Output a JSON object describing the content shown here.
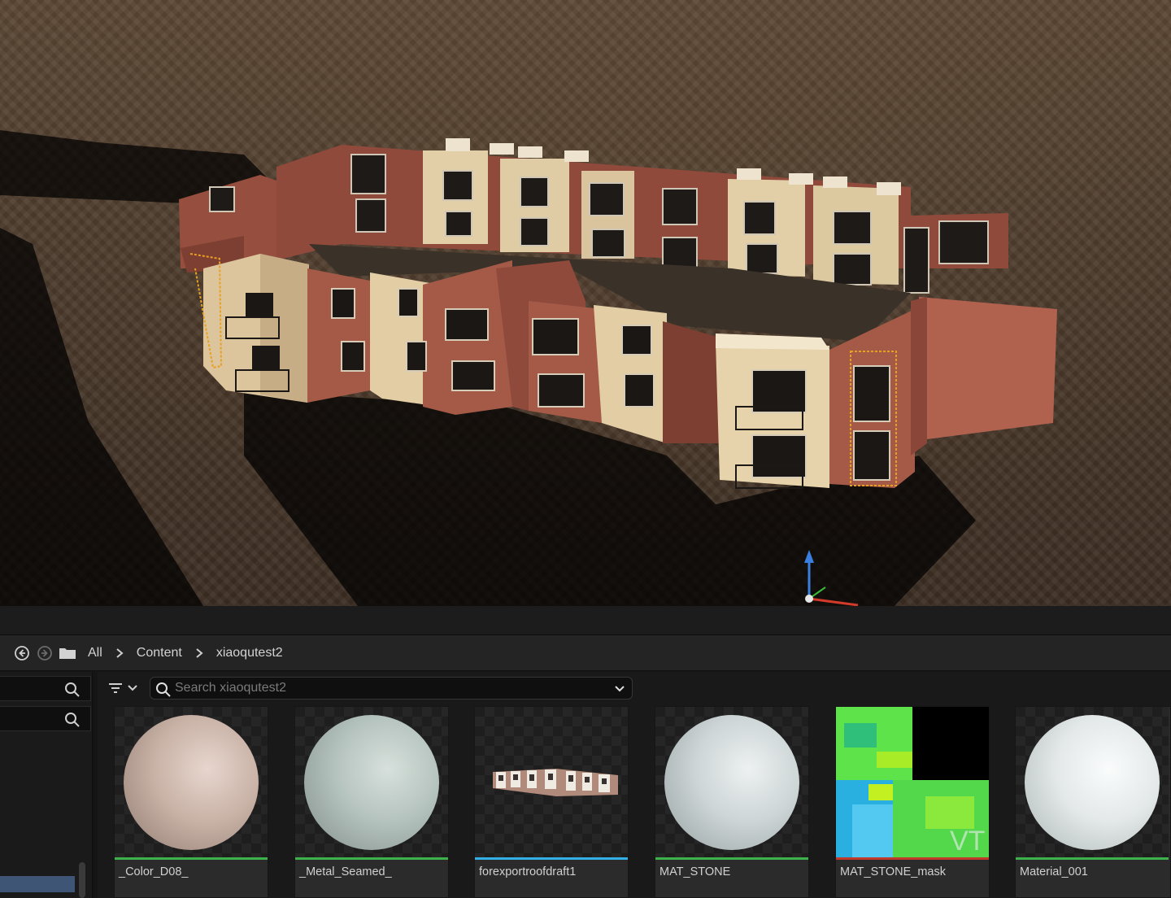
{
  "breadcrumb": {
    "items": [
      "All",
      "Content",
      "xiaoqutest2"
    ]
  },
  "search": {
    "placeholder": "Search xiaoqutest2"
  },
  "assets": [
    {
      "label": "_Color_D08_",
      "type": "material",
      "bar_color": "#3cb34a",
      "sphere_color": "#c8b2a6"
    },
    {
      "label": "_Metal_Seamed_",
      "type": "material",
      "bar_color": "#3cb34a",
      "sphere_color": "#b5c3be"
    },
    {
      "label": "forexportroofdraft1",
      "type": "static-mesh",
      "bar_color": "#33b0e6"
    },
    {
      "label": "MAT_STONE",
      "type": "material",
      "bar_color": "#3cb34a",
      "sphere_color": "#cdd5d6"
    },
    {
      "label": "MAT_STONE_mask",
      "type": "texture",
      "bar_color": "#c0392b"
    },
    {
      "label": "Material_001",
      "type": "material",
      "bar_color": "#3cb34a",
      "sphere_color": "#e3e8e8"
    }
  ],
  "colors": {
    "selection_highlight": "#e8a020",
    "gizmo_z": "#3a7fe0",
    "gizmo_x": "#d23a2a",
    "gizmo_y": "#3aba3a",
    "selected_source": "#3e5575"
  },
  "icons": {
    "back": "arrow-left-circle-icon",
    "forward": "arrow-right-circle-icon",
    "folder": "folder-icon",
    "separator": "chevron-right-icon",
    "search": "search-icon",
    "filter": "filter-icon",
    "dropdown": "chevron-down-icon"
  }
}
